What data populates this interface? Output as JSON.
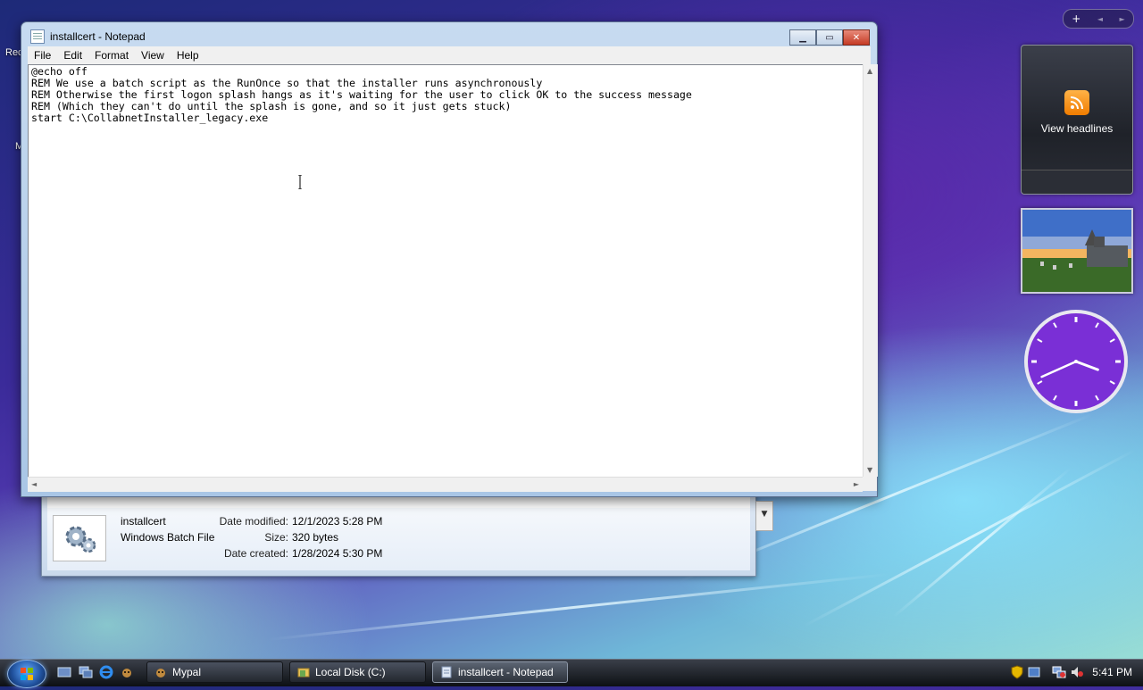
{
  "desktop": {
    "icon_label_1": "Rec",
    "icon_label_2": "M"
  },
  "sidebar": {
    "add_gadget": "+",
    "prev": "◄",
    "next": "►",
    "feed_gadget": {
      "label": "View headlines",
      "icon": "rss-feed-icon"
    },
    "clock_gadget": {
      "hour": 3,
      "minute": 41,
      "face_color": "#7a2fd6"
    }
  },
  "explorer": {
    "file_name": "installcert",
    "file_type": "Windows Batch File",
    "details": [
      {
        "key": "Date modified:",
        "value": "12/1/2023 5:28 PM"
      },
      {
        "key": "Size:",
        "value": "320 bytes"
      },
      {
        "key": "Date created:",
        "value": "1/28/2024 5:30 PM"
      }
    ]
  },
  "notepad": {
    "title": "installcert - Notepad",
    "menu": [
      "File",
      "Edit",
      "Format",
      "View",
      "Help"
    ],
    "content": "@echo off\nREM We use a batch script as the RunOnce so that the installer runs asynchronously\nREM Otherwise the first logon splash hangs as it's waiting for the user to click OK to the success message\nREM (Which they can't do until the splash is gone, and so it just gets stuck)\nstart C:\\CollabnetInstaller_legacy.exe"
  },
  "taskbar": {
    "buttons": [
      {
        "label": "Mypal",
        "icon": "mypal-browser-icon"
      },
      {
        "label": "Local Disk (C:)",
        "icon": "folder-icon"
      },
      {
        "label": "installcert - Notepad",
        "icon": "notepad-icon"
      }
    ],
    "time": "5:41 PM"
  },
  "colors": {
    "accent": "#3b6fd0",
    "close_button": "#c43b25",
    "rss": "#f07c00"
  }
}
